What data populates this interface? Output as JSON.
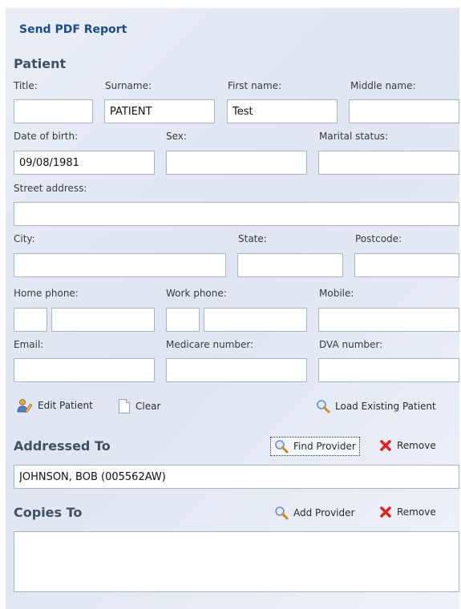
{
  "form": {
    "title": "Send PDF Report"
  },
  "patient": {
    "heading": "Patient",
    "labels": {
      "title": "Title:",
      "surname": "Surname:",
      "first_name": "First name:",
      "middle_name": "Middle name:",
      "dob": "Date of birth:",
      "sex": "Sex:",
      "marital_status": "Marital status:",
      "street": "Street address:",
      "city": "City:",
      "state": "State:",
      "postcode": "Postcode:",
      "home_phone": "Home phone:",
      "work_phone": "Work phone:",
      "mobile": "Mobile:",
      "email": "Email:",
      "medicare": "Medicare number:",
      "dva": "DVA number:"
    },
    "values": {
      "title": "",
      "surname": "PATIENT",
      "first_name": "Test",
      "middle_name": "",
      "dob": "09/08/1981",
      "sex": "",
      "marital_status": "",
      "street": "",
      "city": "",
      "state": "",
      "postcode": "",
      "home_phone_area": "",
      "home_phone": "",
      "work_phone_area": "",
      "work_phone": "",
      "mobile": "",
      "email": "",
      "medicare": "",
      "dva": ""
    },
    "actions": {
      "edit": "Edit Patient",
      "clear": "Clear",
      "load": "Load Existing Patient"
    }
  },
  "addressed_to": {
    "heading": "Addressed To",
    "find_label": "Find Provider",
    "remove_label": "Remove",
    "value": "JOHNSON, BOB (005562AW)"
  },
  "copies_to": {
    "heading": "Copies To",
    "add_label": "Add Provider",
    "remove_label": "Remove",
    "value": ""
  },
  "colors": {
    "title": "#1e4b8f",
    "remove_icon": "#e02020",
    "panel_bg": "#e4eaf3"
  },
  "icons": [
    "edit-patient-icon",
    "clear-icon",
    "search-icon",
    "remove-icon"
  ]
}
